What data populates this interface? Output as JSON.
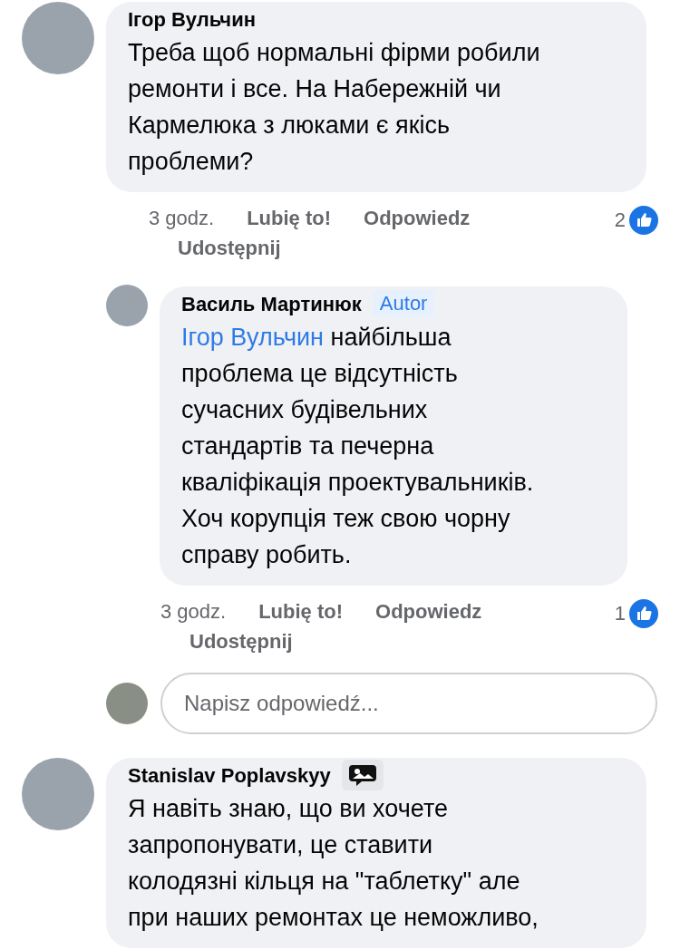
{
  "comments": [
    {
      "author": "Ігор Вульчин",
      "text": "Треба щоб нормальні фірми робили\nремонти і все. На Набережній  чи\nКармелюка з люками є якісь\nпроблеми?",
      "time": "3 godz.",
      "actions": [
        "Lubię to!",
        "Odpowiedz",
        "Udostępnij"
      ],
      "likes": "2",
      "replies": [
        {
          "author": "Василь Мартинюк",
          "badge": {
            "kind": "author",
            "label": "Autor"
          },
          "mention": "Ігор Вульчин",
          "text": " найбільша\nпроблема це відсутність\nсучасних будівельних\nстандартів та печерна\nкваліфікація проектувальників.\nХоч корупція теж свою чорну\nсправу робить.",
          "time": "3 godz.",
          "actions": [
            "Lubię to!",
            "Odpowiedz",
            "Udostępnij"
          ],
          "likes": "1"
        }
      ],
      "reply_box": {
        "placeholder": "Napisz odpowiedź..."
      }
    },
    {
      "author": "Stanislav Poplavskyy",
      "badge": {
        "kind": "icon"
      },
      "text": "Я навіть знаю, що ви хочете\nзапропонувати, це ставити\nколодязні кільця на \"таблетку\" але\nпри наших ремонтах це неможливо,"
    }
  ]
}
